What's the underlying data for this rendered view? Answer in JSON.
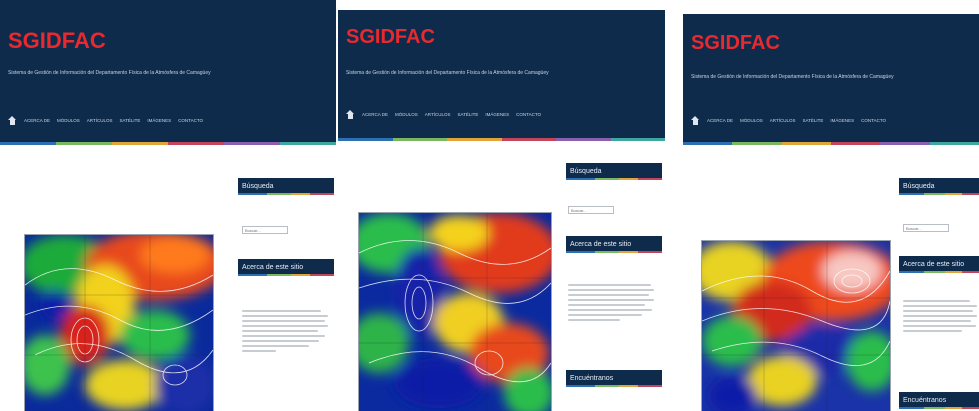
{
  "shots": [
    {
      "brand": "SGIDFAC",
      "tagline": "Sistema de Gestión de Información del Departamento Física de la Atmósfera de Camagüey",
      "nav": [
        "ACERCA DE",
        "MÓDULOS",
        "ARTÍCULOS",
        "SATÉLITE",
        "IMÁGENES",
        "CONTACTO"
      ],
      "search_title": "Búsqueda",
      "search_placeholder": "Buscar...",
      "about_title": "Acerca de este sitio",
      "bottom_title": ""
    },
    {
      "brand": "SGIDFAC",
      "tagline": "Sistema de Gestión de Información del Departamento Física de la Atmósfera de Camagüey",
      "nav": [
        "ACERCA DE",
        "MÓDULOS",
        "ARTÍCULOS",
        "SATÉLITE",
        "IMÁGENES",
        "CONTACTO"
      ],
      "search_title": "Búsqueda",
      "search_placeholder": "Buscar...",
      "about_title": "Acerca de este sitio",
      "bottom_title": "Encuéntranos"
    },
    {
      "brand": "SGIDFAC",
      "tagline": "Sistema de Gestión de Información del Departamento Física de la Atmósfera de Camagüey",
      "nav": [
        "ACERCA DE",
        "MÓDULOS",
        "ARTÍCULOS",
        "SATÉLITE",
        "IMÁGENES",
        "CONTACTO"
      ],
      "search_title": "Búsqueda",
      "search_placeholder": "Buscar...",
      "about_title": "Acerca de este sitio",
      "bottom_title": "Encuéntranos"
    }
  ],
  "colors": {
    "header": "#0f2b4c",
    "brand": "#e8292f",
    "accent_bar": [
      "#2c6fb3",
      "#7bb661",
      "#e0a43b",
      "#c2455b",
      "#8a5fb0",
      "#3fa7a0"
    ]
  },
  "icons": {
    "home": "home-icon"
  }
}
